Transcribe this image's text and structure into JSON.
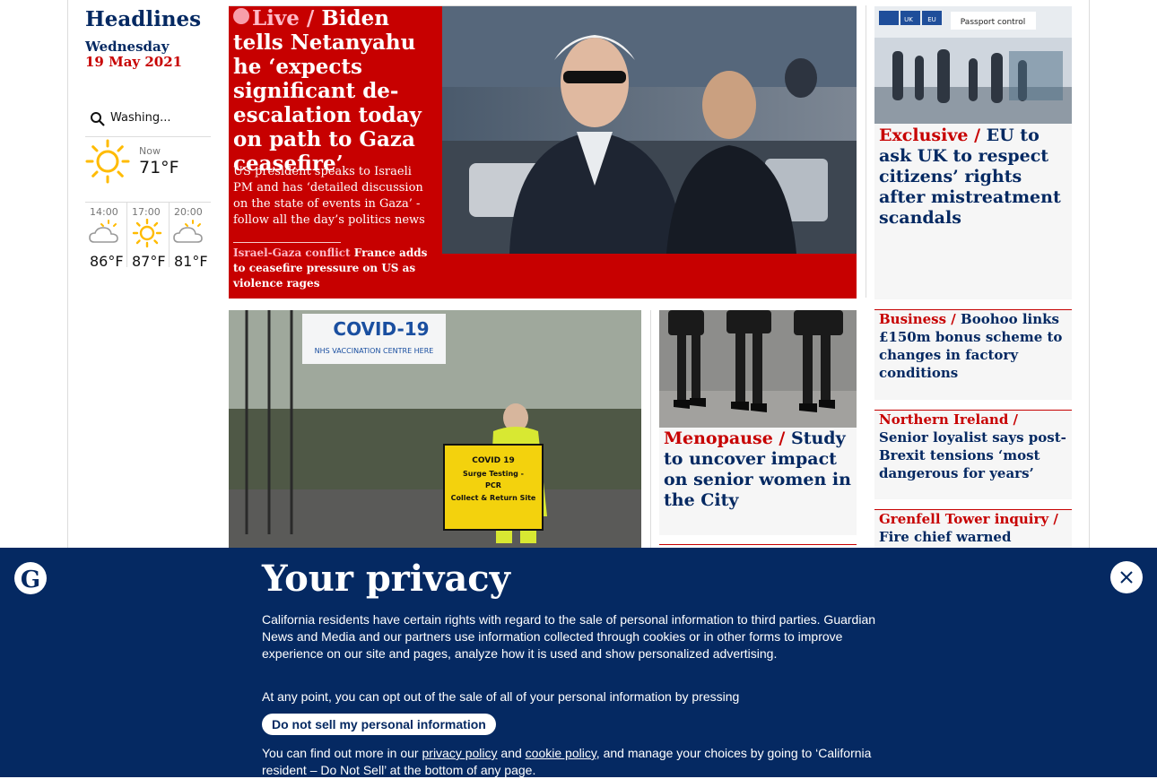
{
  "sidebar": {
    "title": "Headlines",
    "day": "Wednesday",
    "date": "19 May 2021",
    "weather": {
      "location": "Washing...",
      "now_label": "Now",
      "now_temp": "71°F",
      "now_icon": "sun-icon",
      "forecast": [
        {
          "time": "14:00",
          "temp": "86°F",
          "icon": "cloudy-sun-icon"
        },
        {
          "time": "17:00",
          "temp": "87°F",
          "icon": "sun-icon"
        },
        {
          "time": "20:00",
          "temp": "81°F",
          "icon": "cloudy-sun-icon"
        }
      ]
    }
  },
  "live_story": {
    "kicker": "Live /",
    "headline": "Biden tells Netanyahu he ‘expects significant de-escalation today on path to Gaza ceasefire’",
    "standfirst": "US president speaks to Israeli PM and has ‘detailed discussion on the state of events in Gaza’ - follow all the day’s politics news",
    "sub_kicker": "Israel-Gaza conflict",
    "sub_headline": "France adds to ceasefire pressure on US as violence rages"
  },
  "exclusive_story": {
    "kicker": "Exclusive /",
    "headline": "EU to ask UK to respect citizens’ rights after mistreatment scandals",
    "image_signs": [
      "UK",
      "EU",
      "Passport control"
    ]
  },
  "covid_story": {
    "image_banner": "COVID-19",
    "image_banner_sub": "NHS VACCINATION CENTRE HERE",
    "image_sign_lines": [
      "COVID 19",
      "Surge Testing -",
      "PCR",
      "Collect & Return Site"
    ]
  },
  "menopause_story": {
    "kicker": "Menopause /",
    "headline": "Study to uncover impact on senior women in the City"
  },
  "business_story": {
    "kicker": "Business /",
    "headline": "Boohoo links £150m bonus scheme to changes in factory conditions"
  },
  "ni_story": {
    "kicker": "Northern Ireland /",
    "headline": "Senior loyalist says post-Brexit tensions ‘most dangerous for years’"
  },
  "grenfell_story": {
    "kicker": "Grenfell Tower inquiry /",
    "headline": "Fire chief warned council"
  },
  "privacy_banner": {
    "title": "Your privacy",
    "para1": "California residents have certain rights with regard to the sale of personal information to third parties. Guardian News and Media and our partners use information collected through cookies or in other forms to improve experience on our site and pages, analyze how it is used and show personalized advertising.",
    "para2": "At any point, you can opt out of the sale of all of your personal information by pressing",
    "button_label": "Do not sell my personal information",
    "para3_prefix": "You can find out more in our",
    "privacy_link": "privacy policy",
    "and_text": "and",
    "cookie_link": "cookie policy",
    "para3_suffix": ", and manage your choices by going to ‘California resident – Do Not Sell’ at the bottom of any page."
  },
  "colors": {
    "guardian_blue": "#052962",
    "news_red": "#c70000",
    "live_pink": "#ffbac8",
    "card_grey": "#f6f6f6"
  }
}
